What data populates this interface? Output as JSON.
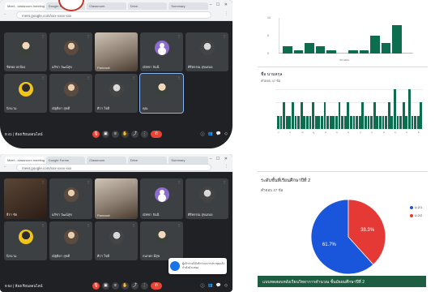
{
  "meet_top": {
    "tabs": [
      "Meet - classroom meeting",
      "Google Forms",
      "Classroom",
      "Drive",
      "Summary"
    ],
    "url": "meet.google.com/xxx-xxxx-xxx",
    "tiles": [
      {
        "name": "ชิตพล ปกป้อง",
        "avatar": "img"
      },
      {
        "name": "อภิชา วัฒน์สุข",
        "avatar": "img2"
      },
      {
        "name": "Panuwat",
        "avatar": "photo"
      },
      {
        "name": "ณัชชา จันนี",
        "avatar": "purple"
      },
      {
        "name": "ศิริพรรณ สุขเสมอ",
        "avatar": "gray"
      },
      {
        "name": "นิรนาม",
        "avatar": "yellow"
      },
      {
        "name": "ณัฐธิดา สุขดี",
        "avatar": "img2"
      },
      {
        "name": "ศิวา ใจดี",
        "avatar": "gray"
      },
      {
        "name": "คุณ",
        "avatar": "img",
        "highlight": true
      }
    ],
    "time": "9:41 | ห้องเรียนออนไลน์",
    "controls": [
      "🎤",
      "📷",
      "✋",
      "⋮"
    ]
  },
  "meet_bottom": {
    "tabs": [
      "Meet - classroom meeting",
      "Google Forms",
      "Classroom",
      "Drive",
      "Summary"
    ],
    "url": "meet.google.com/xxx-xxxx-xxx",
    "tiles": [
      {
        "name": "ธีรา ชัย",
        "avatar": "cam"
      },
      {
        "name": "อภิชา วัฒน์สุข",
        "avatar": "img2"
      },
      {
        "name": "Panuwat",
        "avatar": "photo"
      },
      {
        "name": "ณัชชา จันนี",
        "avatar": "purple"
      },
      {
        "name": "ศิริพรรณ สุขเสมอ",
        "avatar": "gray"
      },
      {
        "name": "นิรนาม",
        "avatar": "yellow"
      },
      {
        "name": "ณัฐธิดา สุขดี",
        "avatar": "img2"
      },
      {
        "name": "ศิวา ใจดี",
        "avatar": "gray"
      },
      {
        "name": "กนกพร มีสุข",
        "avatar": "img"
      }
    ],
    "time": "9:52 | ห้องเรียนออนไลน์",
    "toast": "ผู้เข้าร่วมได้เข้าร่วมการประชุมแล้ว กำลังนำเสนอ"
  },
  "chart_data": [
    {
      "type": "bar",
      "title": "",
      "xlabel": "คะแนน",
      "ylabel": "",
      "categories": [
        "1",
        "2",
        "3",
        "4",
        "5",
        "6",
        "7",
        "8",
        "9",
        "10",
        "11",
        "12"
      ],
      "values": [
        2,
        1,
        3,
        2,
        1,
        0,
        1,
        1,
        5,
        3,
        8,
        0
      ],
      "ylim": [
        0,
        10
      ]
    },
    {
      "type": "bar",
      "title": "ชื่อ นามสกุล",
      "subtitle": "คำตอบ 47 ข้อ",
      "categories": [
        "ก",
        "ข",
        "ค",
        "ง",
        "จ",
        "ฉ",
        "ช",
        "ซ",
        "ฌ",
        "ญ",
        "ฎ",
        "ฏ",
        "ฐ",
        "ฑ",
        "ฒ",
        "ณ",
        "ด",
        "ต",
        "ถ",
        "ท",
        "ธ",
        "น",
        "บ",
        "ป",
        "ผ",
        "ฝ",
        "พ",
        "ฟ",
        "ภ",
        "ม",
        "ย",
        "ร",
        "ล",
        "ว",
        "ศ",
        "ษ",
        "ส",
        "ห",
        "ฬ",
        "อ",
        "ฮ",
        "1",
        "2",
        "3",
        "4",
        "5",
        "6",
        "7",
        "8",
        "9"
      ],
      "values": [
        1,
        1,
        2,
        1,
        1,
        2,
        1,
        1,
        2,
        1,
        1,
        1,
        2,
        1,
        1,
        1,
        2,
        1,
        1,
        1,
        1,
        2,
        1,
        1,
        2,
        1,
        1,
        1,
        1,
        2,
        1,
        1,
        1,
        2,
        1,
        1,
        1,
        1,
        2,
        1,
        3,
        1,
        1,
        2,
        1,
        3,
        1,
        1,
        1,
        2
      ],
      "ylim": [
        0,
        3
      ]
    },
    {
      "type": "pie",
      "title": "ระดับชั้นที่เรียนศึกษาปีที่ 2",
      "subtitle": "คำตอบ 47 ข้อ",
      "labels": [
        "ม.2/1",
        "ม.2/2"
      ],
      "values": [
        61.7,
        38.3
      ],
      "slice_labels": [
        "61.7%",
        "38.3%"
      ],
      "colors": [
        "#1a56db",
        "#e53935"
      ]
    }
  ],
  "banner": "แบบทดสอบหลังเรียนวิทยาการคำนวณ ชั้นมัธยมศึกษาปีที่ 2"
}
